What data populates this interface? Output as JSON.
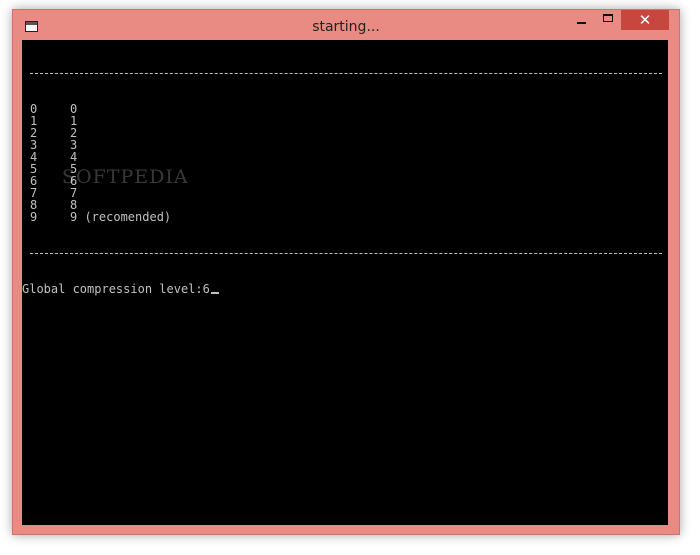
{
  "window": {
    "title": "starting...",
    "close_glyph": "✕"
  },
  "console": {
    "levels": [
      {
        "level": "0",
        "value": "0"
      },
      {
        "level": "1",
        "value": "1"
      },
      {
        "level": "2",
        "value": "2"
      },
      {
        "level": "3",
        "value": "3"
      },
      {
        "level": "4",
        "value": "4"
      },
      {
        "level": "5",
        "value": "5"
      },
      {
        "level": "6",
        "value": "6"
      },
      {
        "level": "7",
        "value": "7"
      },
      {
        "level": "8",
        "value": "8"
      },
      {
        "level": "9",
        "value": "9 (recomended)"
      }
    ],
    "prompt_label": "Global compression level:",
    "input_value": "6"
  },
  "watermark": "SOFTPEDIA",
  "colors": {
    "titlebar": "#e98b83",
    "close_button": "#c7473e",
    "console_bg": "#000000",
    "console_text": "#c0c0c0"
  }
}
